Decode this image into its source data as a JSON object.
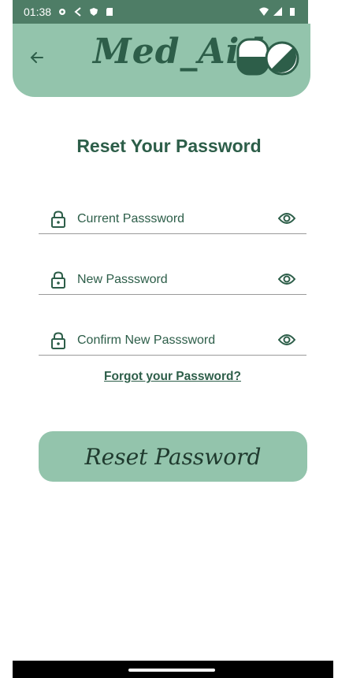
{
  "status_bar": {
    "time": "01:38"
  },
  "header": {
    "logo_text": "Med_Aid"
  },
  "page": {
    "title": "Reset Your Password"
  },
  "fields": [
    {
      "placeholder": "Current Passsword"
    },
    {
      "placeholder": "New Passsword"
    },
    {
      "placeholder": "Confirm New Passsword"
    }
  ],
  "links": {
    "forgot": "Forgot your Password?"
  },
  "buttons": {
    "reset": "Reset Password"
  },
  "colors": {
    "primary": "#2d5e49",
    "header_bg": "#93c4ac",
    "status_bar_bg": "#4e7d66"
  },
  "icons": {
    "back": "arrow-left-icon",
    "lock": "lock-icon",
    "eye": "eye-icon",
    "logo": "pill-icon"
  }
}
